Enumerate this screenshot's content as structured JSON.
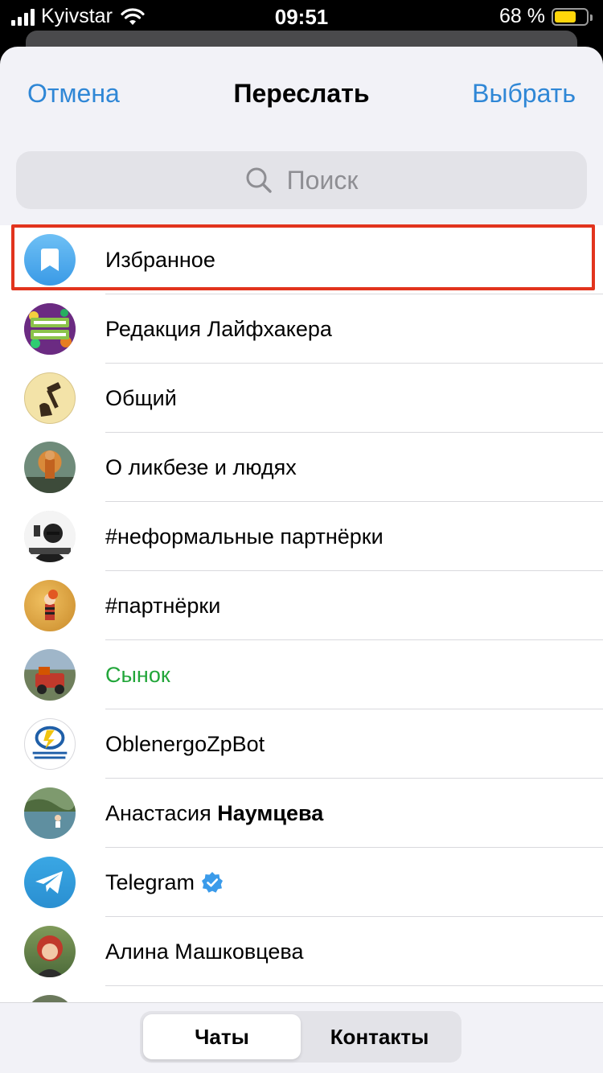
{
  "status_bar": {
    "carrier": "Kyivstar",
    "time": "09:51",
    "battery": "68 %",
    "battery_level": 0.68
  },
  "nav": {
    "cancel": "Отмена",
    "title": "Переслать",
    "select": "Выбрать"
  },
  "search": {
    "placeholder": "Поиск"
  },
  "chats": [
    {
      "name": "Избранное",
      "icon": "bookmark-icon"
    },
    {
      "name": "Редакция Лайфхакера",
      "icon": "lifehacker-logo"
    },
    {
      "name": "Общий",
      "icon": "hammer-icon"
    },
    {
      "name": "О ликбезе и людях"
    },
    {
      "name": "#неформальные партнёрки"
    },
    {
      "name": "#партнёрки"
    },
    {
      "name": "Сынок"
    },
    {
      "name": "OblenergoZpBot",
      "icon": "oblenergo-logo"
    },
    {
      "first": "Анастасия",
      "last": "Наумцева"
    },
    {
      "name": "Telegram",
      "icon": "paper-plane-icon",
      "badge_icon": "verified-badge-icon"
    },
    {
      "name": "Алина Машковцева"
    }
  ],
  "tabs": {
    "chats": "Чаты",
    "contacts": "Контакты"
  },
  "colors": {
    "accent": "#2f87d6",
    "highlight": "#e2341d",
    "online_green": "#22a63a",
    "battery": "#ffd60a"
  }
}
